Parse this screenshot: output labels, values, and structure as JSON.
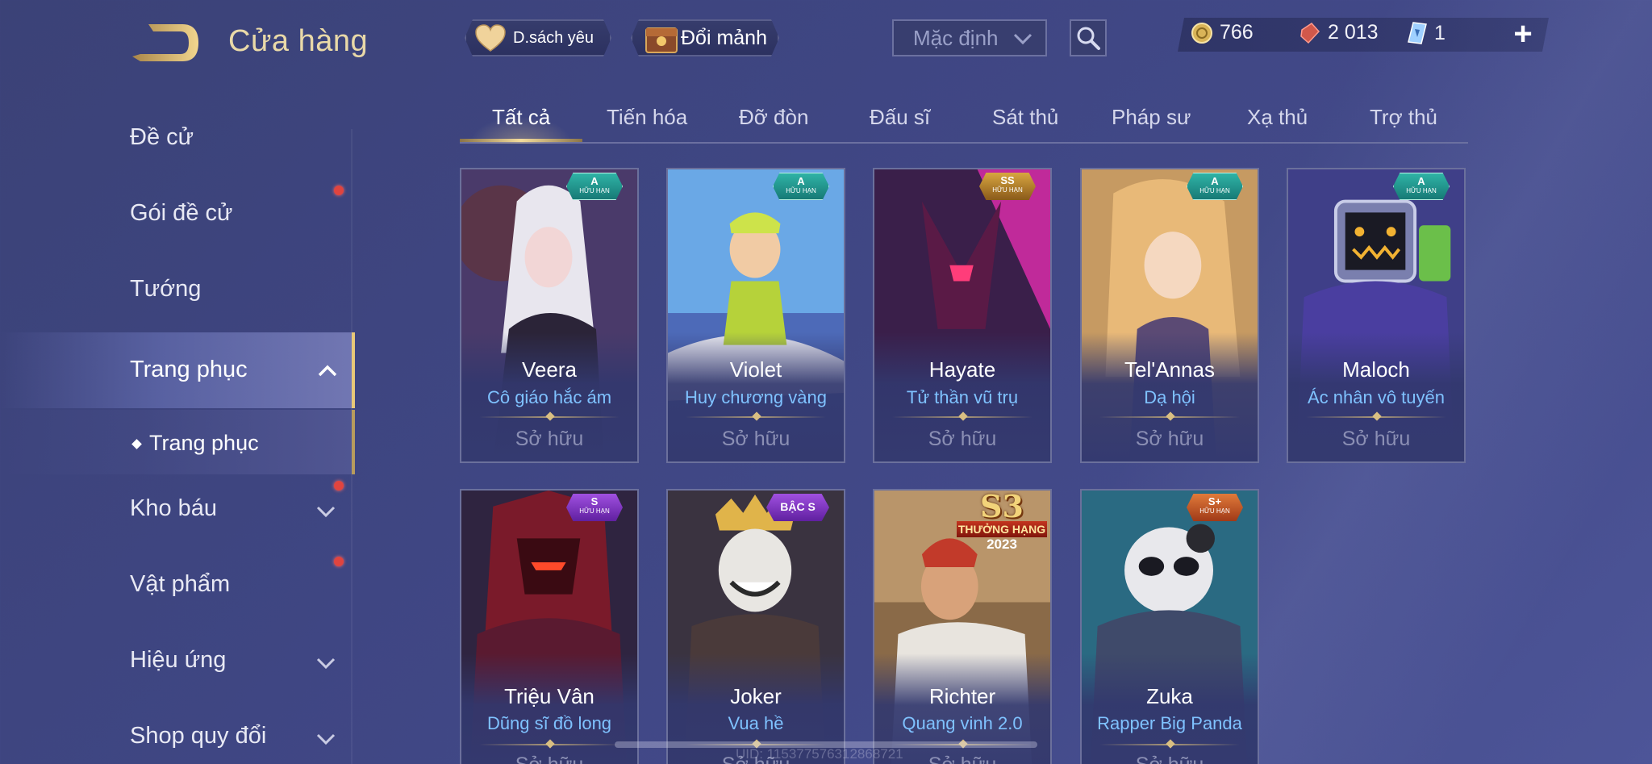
{
  "header": {
    "title": "Cửa hàng",
    "wishlist_label": "D.sách yêu",
    "shard_label": "Đổi mảnh",
    "sort_value": "Mặc định",
    "currency": {
      "gold": "766",
      "voucher": "2 013",
      "card": "1"
    },
    "plus": "+"
  },
  "sidebar": {
    "items": [
      {
        "label": "Đề cử"
      },
      {
        "label": "Gói đề cử"
      },
      {
        "label": "Tướng"
      },
      {
        "label": "Trang phục"
      },
      {
        "label": "Trang phục"
      },
      {
        "label": "Kho báu"
      },
      {
        "label": "Vật phẩm"
      },
      {
        "label": "Hiệu ứng"
      },
      {
        "label": "Shop quy đổi"
      }
    ]
  },
  "tabs": [
    {
      "label": "Tất cả"
    },
    {
      "label": "Tiến hóa"
    },
    {
      "label": "Đỡ đòn"
    },
    {
      "label": "Đấu sĩ"
    },
    {
      "label": "Sát thủ"
    },
    {
      "label": "Pháp sư"
    },
    {
      "label": "Xạ thủ"
    },
    {
      "label": "Trợ thủ"
    }
  ],
  "cards": [
    {
      "hero": "Veera",
      "skin": "Cô giáo hắc ám",
      "status": "Sở hữu",
      "badge_top": "A",
      "badge_sub": "HỮU HẠN",
      "badge_color": "#2fb3a6"
    },
    {
      "hero": "Violet",
      "skin": "Huy chương vàng",
      "status": "Sở hữu",
      "badge_top": "A",
      "badge_sub": "HỮU HẠN",
      "badge_color": "#2fb3a6"
    },
    {
      "hero": "Hayate",
      "skin": "Tử thần vũ trụ",
      "status": "Sở hữu",
      "badge_top": "SS",
      "badge_sub": "HỮU HẠN",
      "badge_color": "#d8a640"
    },
    {
      "hero": "Tel'Annas",
      "skin": "Dạ hội",
      "status": "Sở hữu",
      "badge_top": "A",
      "badge_sub": "HỮU HẠN",
      "badge_color": "#2fb3a6"
    },
    {
      "hero": "Maloch",
      "skin": "Ác nhân vô tuyến",
      "status": "Sở hữu",
      "badge_top": "A",
      "badge_sub": "HỮU HẠN",
      "badge_color": "#2fb3a6"
    },
    {
      "hero": "Triệu Vân",
      "skin": "Dũng sĩ đồ long",
      "status": "Sở hữu",
      "badge_top": "S",
      "badge_sub": "HỮU HẠN",
      "badge_color": "#a050e0"
    },
    {
      "hero": "Joker",
      "skin": "Vua hề",
      "status": "Sở hữu",
      "badge_top": "BẬC S",
      "badge_sub": "",
      "badge_color": "#a050e0"
    },
    {
      "hero": "Richter",
      "skin": "Quang vinh 2.0",
      "status": "Sở hữu",
      "badge_top": "S3",
      "badge_sub": "THƯỞNG HẠNG",
      "badge_year": "2023",
      "badge_color": "#c4341e"
    },
    {
      "hero": "Zuka",
      "skin": "Rapper Big Panda",
      "status": "Sở hữu",
      "badge_top": "S+",
      "badge_sub": "HỮU HẠN",
      "badge_color": "#e07a3a"
    }
  ],
  "footer": {
    "uid": "UID: 115377576312868721"
  },
  "colors": {
    "accent_gold": "#e9c978",
    "skin_name_blue": "#7fc2ff",
    "notification_red": "#e0443f"
  },
  "icons": {
    "back": "back-arrow-icon",
    "wishlist": "heart-icon",
    "shard": "shard-chest-icon",
    "sort": "chevron-down-icon",
    "search": "search-icon",
    "gold": "gold-coin-icon",
    "voucher": "voucher-icon",
    "card": "card-icon",
    "plus": "plus-icon"
  }
}
